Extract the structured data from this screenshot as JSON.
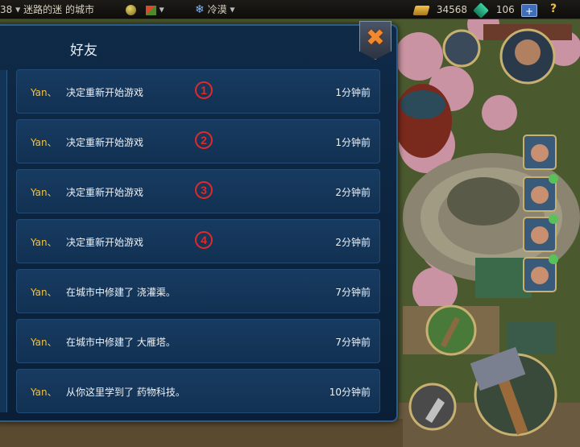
{
  "topbar": {
    "city_number": "38",
    "city_name": "迷路的迷",
    "city_suffix": "的城市",
    "weather": "冷漠",
    "gold": "34568",
    "gems": "106",
    "add": "+",
    "help": "?"
  },
  "panel": {
    "title": "好友",
    "close": "✖"
  },
  "entries": [
    {
      "who": "Yan、",
      "what": "决定重新开始游戏",
      "when": "1分钟前",
      "marker": "1"
    },
    {
      "who": "Yan、",
      "what": "决定重新开始游戏",
      "when": "1分钟前",
      "marker": "2"
    },
    {
      "who": "Yan、",
      "what": "决定重新开始游戏",
      "when": "2分钟前",
      "marker": "3"
    },
    {
      "who": "Yan、",
      "what": "决定重新开始游戏",
      "when": "2分钟前",
      "marker": "4"
    },
    {
      "who": "Yan、",
      "what": "在城市中修建了 浇灌渠。",
      "when": "7分钟前"
    },
    {
      "who": "Yan、",
      "what": "在城市中修建了 大雁塔。",
      "when": "7分钟前"
    },
    {
      "who": "Yan、",
      "what": "从你这里学到了 药物科技。",
      "when": "10分钟前"
    }
  ],
  "colors": {
    "panel_bg": "#0f2a47",
    "entry_bg": "#173b61",
    "player_name": "#f0c24a",
    "marker": "#e02a2a",
    "close_icon": "#f08a30"
  },
  "icons": [
    "gold-coin-icon",
    "flag-icon",
    "snowflake-icon",
    "gold-icon",
    "gem-icon",
    "plus-icon",
    "help-icon",
    "close-icon",
    "map-icon",
    "advisor-avatar-icon",
    "shovel-icon",
    "hammer-icon",
    "road-icon"
  ]
}
